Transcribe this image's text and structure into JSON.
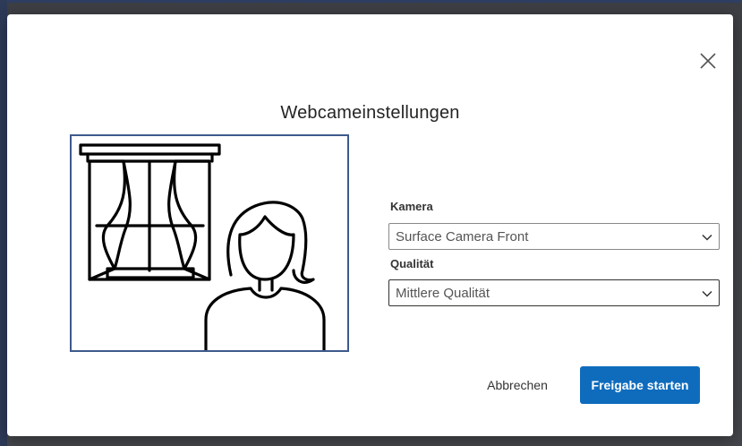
{
  "dialog": {
    "title": "Webcameinstellungen",
    "close_icon": "close-icon"
  },
  "preview": {
    "illustration": "webcam-preview-placeholder"
  },
  "camera": {
    "label": "Kamera",
    "value": "Surface Camera Front"
  },
  "quality": {
    "label": "Qualität",
    "value": "Mittlere Qualität"
  },
  "actions": {
    "cancel_label": "Abbrechen",
    "start_label": "Freigabe starten"
  },
  "colors": {
    "primary": "#0f6cbd",
    "preview_border": "#3d5a8c"
  }
}
